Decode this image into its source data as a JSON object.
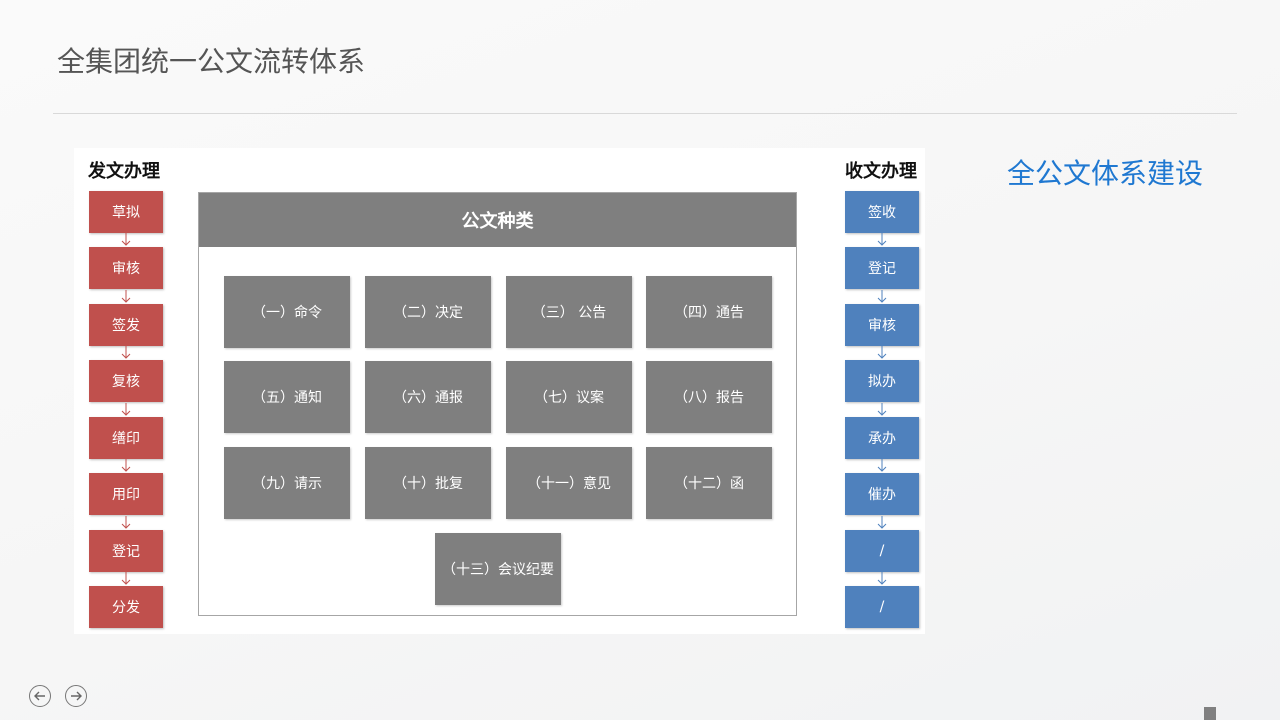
{
  "page": {
    "title": "全集团统一公文流转体系",
    "side_title": "全公文体系建设"
  },
  "send": {
    "heading": "发文办理",
    "steps": [
      "草拟",
      "审核",
      "签发",
      "复核",
      "缮印",
      "用印",
      "登记",
      "分发"
    ]
  },
  "receive": {
    "heading": "收文办理",
    "steps": [
      "签收",
      "登记",
      "审核",
      "拟办",
      "承办",
      "催办",
      "/",
      "/"
    ]
  },
  "categories": {
    "header": "公文种类",
    "items": [
      "（一）命令",
      "（二）决定",
      "（三） 公告",
      "（四）通告",
      "（五）通知",
      "（六）通报",
      "（七）议案",
      "（八）报告",
      "（九）请示",
      "（十）批复",
      "（十一）意见",
      "（十二）函",
      "（十三）会议纪要"
    ]
  },
  "colors": {
    "send_step": "#c0504d",
    "receive_step": "#4f81bd",
    "category_box": "#7f7f7f",
    "side_title": "#1f78d1"
  },
  "nav": {
    "prev_icon": "arrow-left-circle-icon",
    "next_icon": "arrow-right-circle-icon"
  }
}
